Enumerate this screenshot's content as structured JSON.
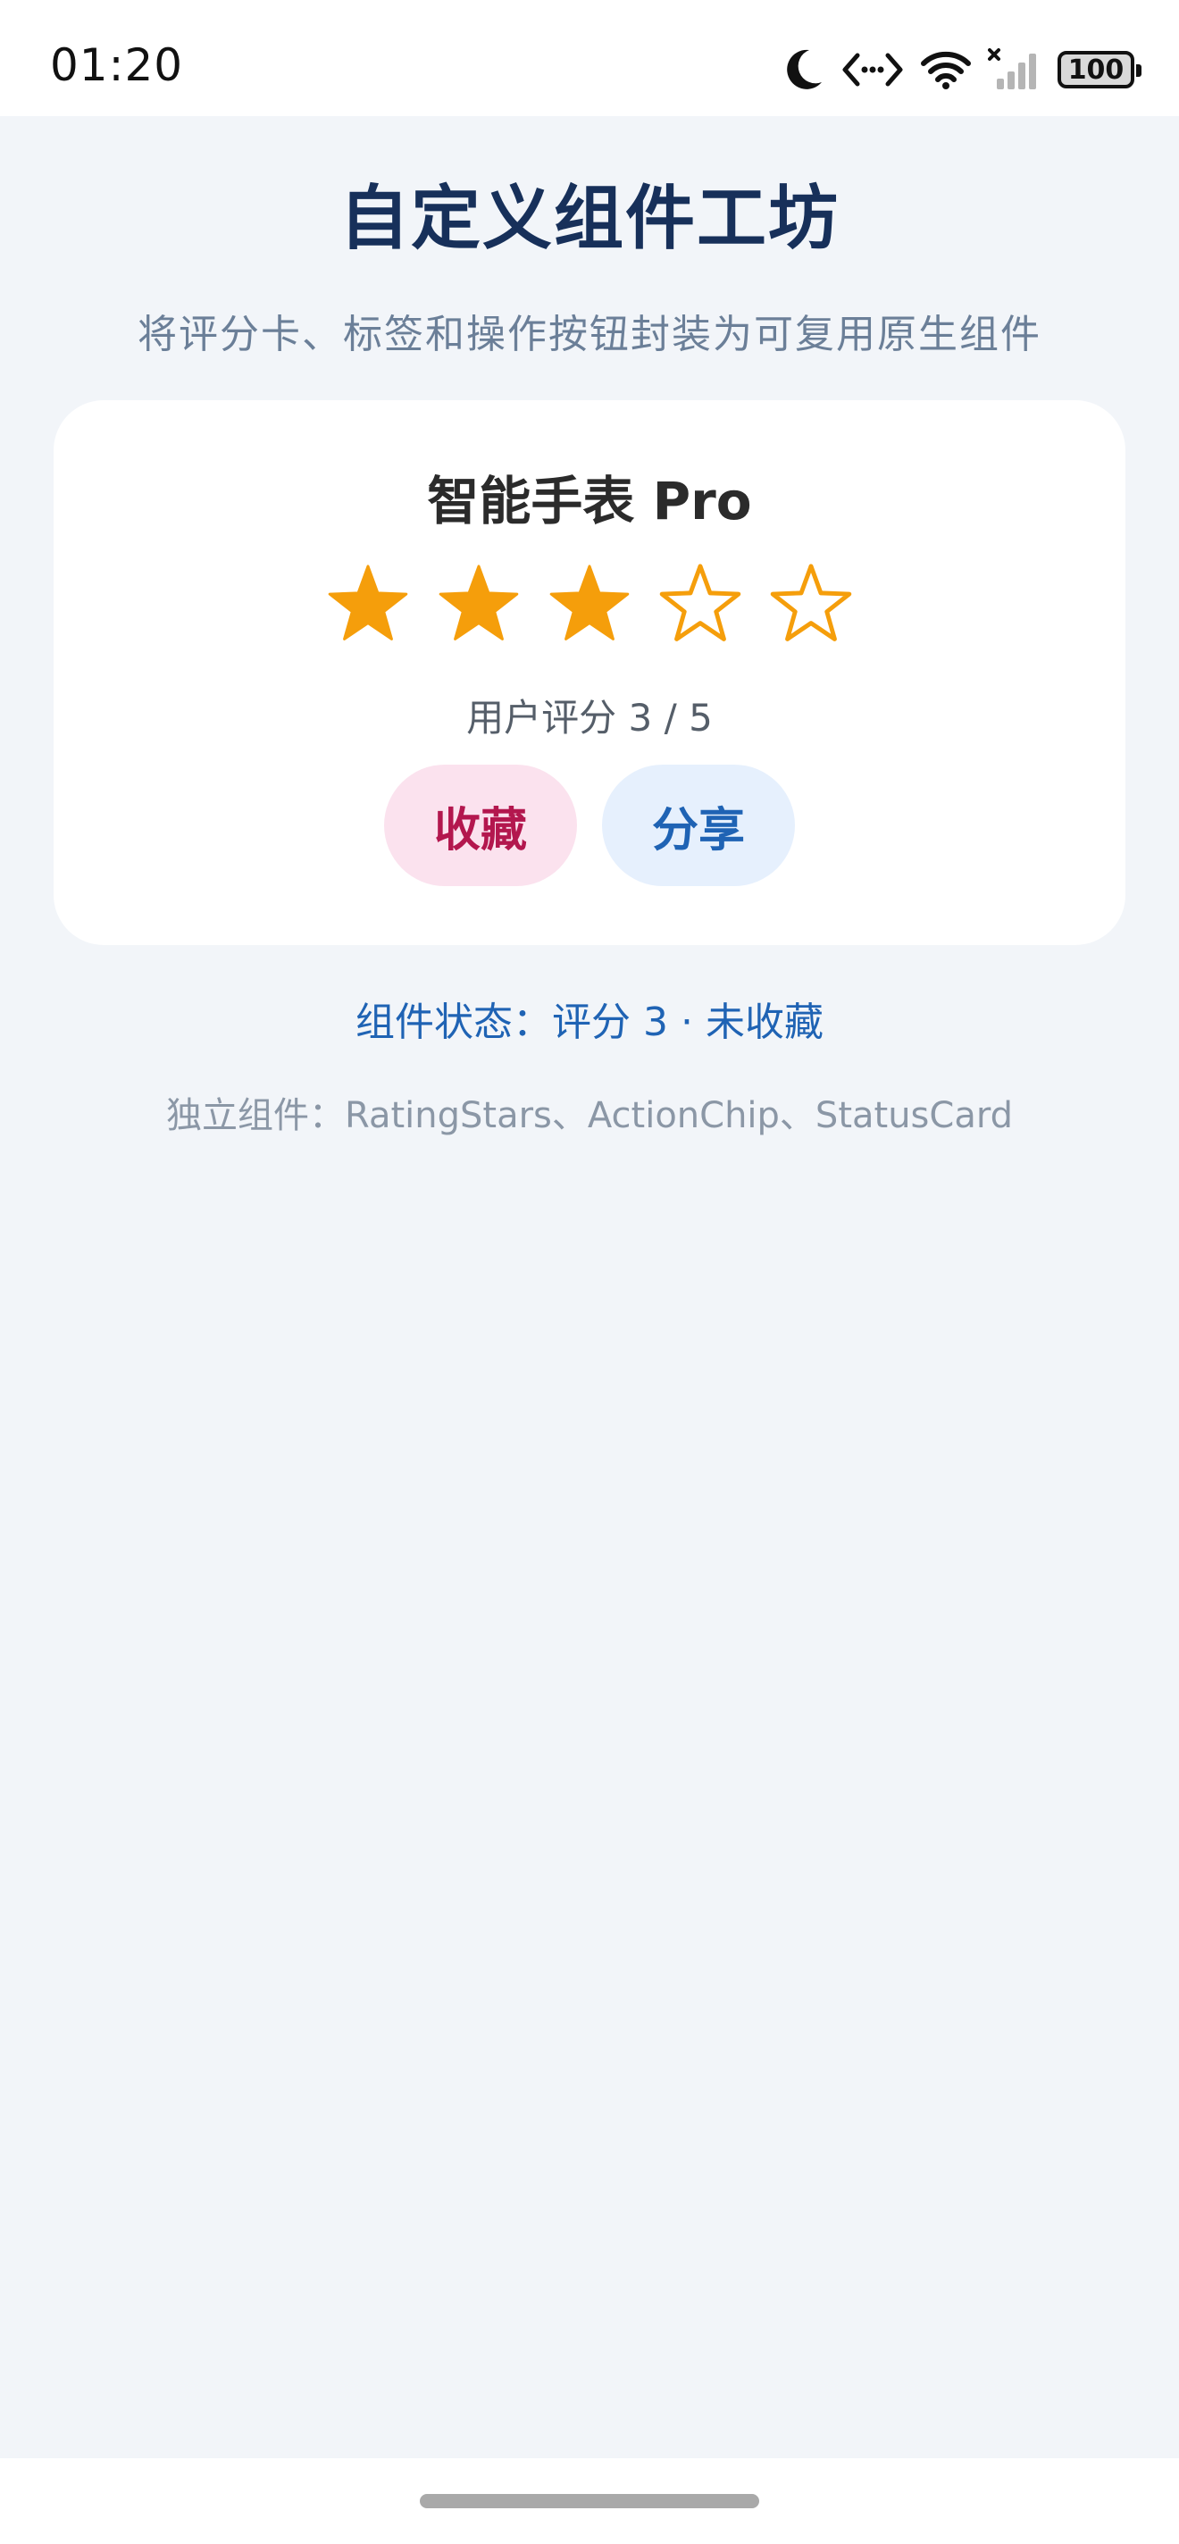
{
  "status_bar": {
    "time": "01:20",
    "icons": [
      "moon-icon",
      "code-icon",
      "wifi-icon",
      "signal-icon",
      "battery-icon"
    ],
    "battery": "100"
  },
  "header": {
    "title": "自定义组件工坊",
    "subtitle": "将评分卡、标签和操作按钮封装为可复用原生组件"
  },
  "card": {
    "title": "智能手表 Pro",
    "rating": 3,
    "max_rating": 5,
    "rating_text": "用户评分 3 / 5",
    "favorite_label": "收藏",
    "share_label": "分享"
  },
  "footer": {
    "state_text": "组件状态：评分 3 · 未收藏",
    "components_text": "独立组件：RatingStars、ActionChip、StatusCard"
  },
  "colors": {
    "star": "#f59e0b",
    "title": "#17305a",
    "accent": "#1f63b4",
    "favorite": "#b3174e"
  }
}
